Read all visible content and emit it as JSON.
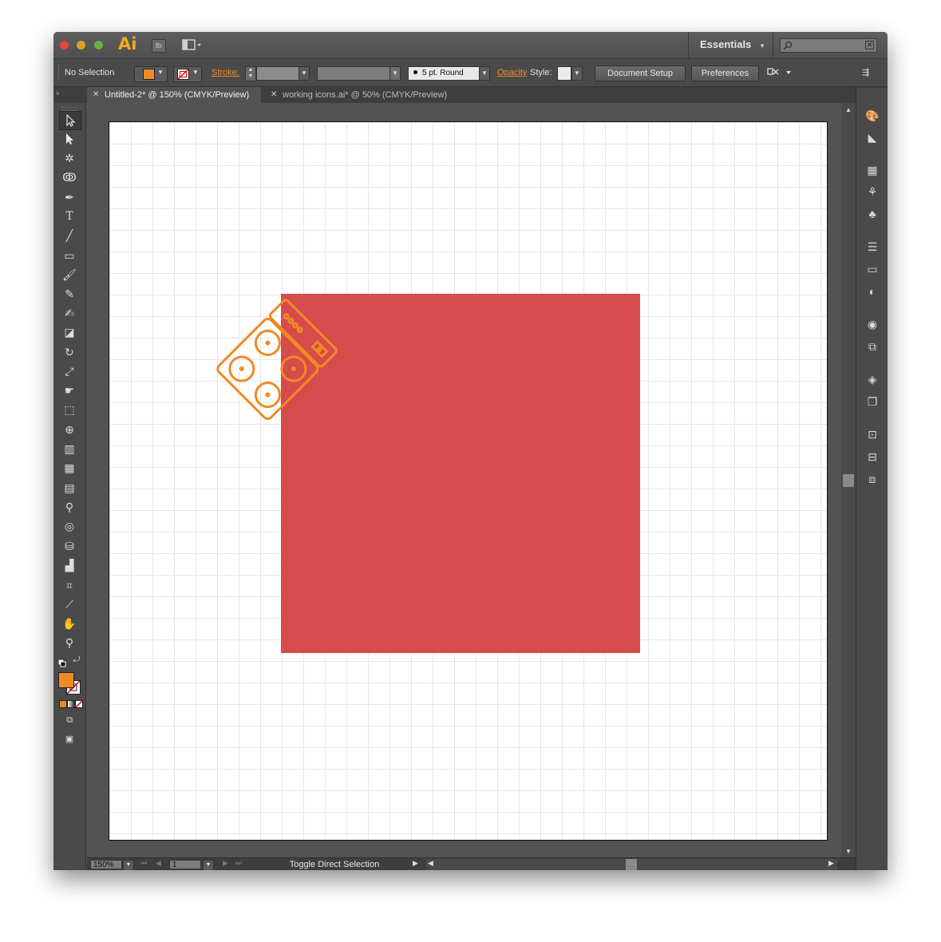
{
  "app": {
    "logo": "Ai",
    "bridge_label": "Br",
    "workspace": "Essentials",
    "search_placeholder": ""
  },
  "control_bar": {
    "selection_label": "No Selection",
    "fill_color": "#f08a24",
    "stroke_label": "Stroke:",
    "brush_label": "5 pt. Round",
    "opacity_label": "Opacity",
    "style_label": "Style:",
    "document_setup_label": "Document Setup",
    "preferences_label": "Preferences"
  },
  "tabs": [
    {
      "label": "Untitled-2* @ 150% (CMYK/Preview)",
      "active": true
    },
    {
      "label": "working icons.ai* @ 50% (CMYK/Preview)",
      "active": false
    }
  ],
  "tools": [
    "selection-tool",
    "direct-selection-tool",
    "magic-wand-tool",
    "lasso-tool",
    "pen-tool",
    "type-tool",
    "line-segment-tool",
    "rectangle-tool",
    "paintbrush-tool",
    "pencil-tool",
    "blob-brush-tool",
    "eraser-tool",
    "rotate-tool",
    "scale-tool",
    "warp-tool",
    "free-transform-tool",
    "shape-builder-tool",
    "perspective-grid-tool",
    "mesh-tool",
    "gradient-tool",
    "eyedropper-tool",
    "blend-tool",
    "symbol-sprayer-tool",
    "column-graph-tool",
    "artboard-tool",
    "slice-tool",
    "hand-tool",
    "zoom-tool"
  ],
  "artwork": {
    "red_square_color": "#d64b4b",
    "icon_color": "#f08a24"
  },
  "status_bar": {
    "zoom": "150%",
    "artboard_number": "1",
    "status_text": "Toggle Direct Selection"
  }
}
